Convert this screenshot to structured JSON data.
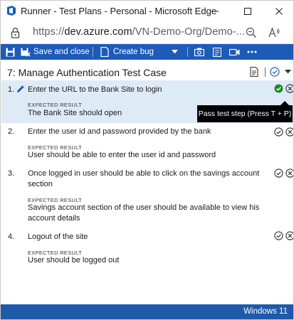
{
  "window": {
    "title": "Runner - Test Plans - Personal - Microsoft Edge",
    "url_scheme": "https://",
    "url_host": "dev.azure.com",
    "url_path": "/VN-Demo-Org/Demo-..."
  },
  "toolbar": {
    "save_close_label": "Save and close",
    "create_bug_label": "Create bug"
  },
  "test_case": {
    "title": "7: Manage Authentication Test Case"
  },
  "steps": [
    {
      "number": "1.",
      "action": "Enter the URL to the Bank Site to login",
      "expected_label": "EXPECTED RESULT",
      "expected": "The Bank Site should open"
    },
    {
      "number": "2.",
      "action": "Enter the user id and password provided by the bank",
      "expected_label": "EXPECTED RESULT",
      "expected": "User should be able to enter the user id and password"
    },
    {
      "number": "3.",
      "action": "Once logged in user should be able to click on the savings account section",
      "expected_label": "EXPECTED RESULT",
      "expected": "Savings account section of the user should be available to view his account details"
    },
    {
      "number": "4.",
      "action": "Logout of the site",
      "expected_label": "EXPECTED RESULT",
      "expected": "User should be logged out"
    }
  ],
  "tooltip": {
    "text": "Pass test step (Press T + P)"
  },
  "status_bar": {
    "text": "Windows 11"
  },
  "colors": {
    "toolbar_bg": "#1d5bb8",
    "active_row_bg": "#dfeaf7",
    "pass_green": "#1e8a2a",
    "status_bar_bg": "#1e5aa8"
  },
  "icons": [
    "azure-test-plans-icon",
    "minimize-icon",
    "maximize-icon",
    "close-icon",
    "lock-icon",
    "zoom-out-icon",
    "read-aloud-icon",
    "save-icon",
    "save-close-icon",
    "create-bug-icon",
    "chevron-down-icon",
    "screenshot-icon",
    "document-icon",
    "video-icon",
    "more-icon",
    "notes-icon",
    "status-circle-icon",
    "pencil-icon",
    "pass-icon",
    "fail-icon"
  ]
}
